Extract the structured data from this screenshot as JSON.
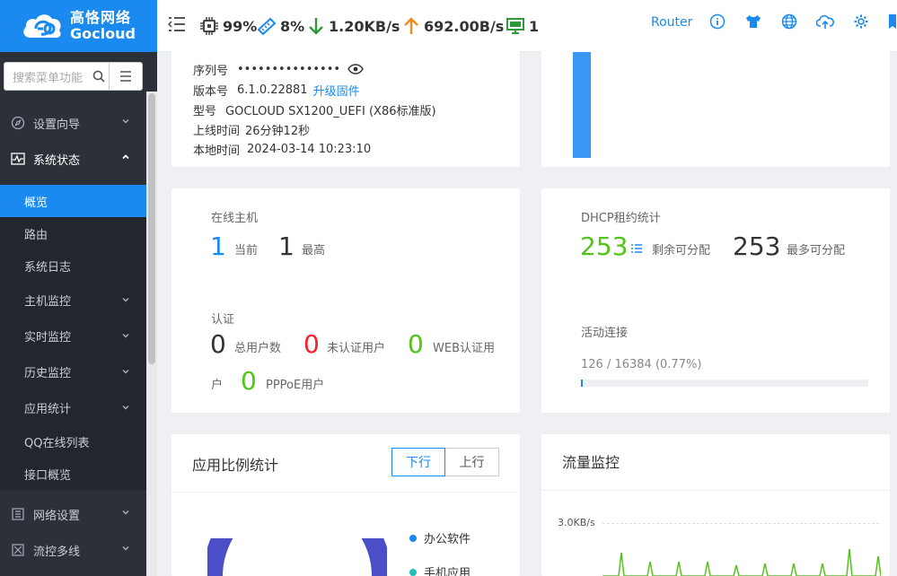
{
  "logo": {
    "cn": "高恪网络",
    "en": "Gocloud"
  },
  "header": {
    "cpu": "99%",
    "mem": "8%",
    "down_speed": "1.20KB/s",
    "up_speed": "692.00B/s",
    "hosts": "1",
    "router_link": "Router",
    "icons": [
      "info-icon",
      "shirt-icon",
      "globe-icon",
      "cloud-upload-icon",
      "gear-icon",
      "bookmark-icon"
    ]
  },
  "sidebar": {
    "search_placeholder": "搜索菜单功能",
    "items": [
      {
        "label": "设置向导",
        "icon": "compass-icon"
      },
      {
        "label": "系统状态",
        "icon": "pulse-icon"
      }
    ],
    "sub_items": [
      {
        "label": "概览"
      },
      {
        "label": "路由"
      },
      {
        "label": "系统日志"
      },
      {
        "label": "主机监控"
      },
      {
        "label": "实时监控"
      },
      {
        "label": "历史监控"
      },
      {
        "label": "应用统计"
      },
      {
        "label": "QQ在线列表"
      },
      {
        "label": "接口概览"
      }
    ],
    "bottom_items": [
      {
        "label": "网络设置",
        "icon": "network-icon"
      },
      {
        "label": "流控多线",
        "icon": "flow-icon"
      }
    ]
  },
  "system_info": {
    "serial_label": "序列号",
    "serial_value": "•••••••••••••••",
    "version_label": "版本号",
    "version_value": "6.1.0.22881",
    "upgrade_link": "升级固件",
    "model_label": "型号",
    "model_value": "GOCLOUD SX1200_UEFI (X86标准版)",
    "uptime_label": "上线时间",
    "uptime_value": "26分钟12秒",
    "localtime_label": "本地时间",
    "localtime_value": "2024-03-14 10:23:10"
  },
  "online_hosts": {
    "title": "在线主机",
    "current_value": "1",
    "current_label": "当前",
    "max_value": "1",
    "max_label": "最高"
  },
  "auth": {
    "title": "认证",
    "total_value": "0",
    "total_label": "总用户数",
    "unauth_value": "0",
    "unauth_label": "未认证用户",
    "web_value": "0",
    "web_label": "WEB认证用",
    "web_label_cont": "户",
    "pppoe_value": "0",
    "pppoe_label": "PPPoE用户"
  },
  "dhcp": {
    "title": "DHCP租约统计",
    "remaining_value": "253",
    "remaining_label": "剩余可分配",
    "max_value": "253",
    "max_label": "最多可分配"
  },
  "connections": {
    "title": "活动连接",
    "text": "126 / 16384 (0.77%)",
    "fraction": 0.0077
  },
  "app_ratio": {
    "title": "应用比例统计",
    "tab_down": "下行",
    "tab_up": "上行",
    "legend": [
      {
        "label": "办公软件",
        "color": "#1a8af0"
      },
      {
        "label": "手机应用",
        "color": "#20c0b8"
      }
    ],
    "donut_color": "#4a4fc8"
  },
  "traffic": {
    "title": "流量监控",
    "y_tick": "3.0KB/s"
  },
  "colors": {
    "accent": "#1a8af0",
    "green": "#52c41a",
    "red": "#f5222d"
  }
}
